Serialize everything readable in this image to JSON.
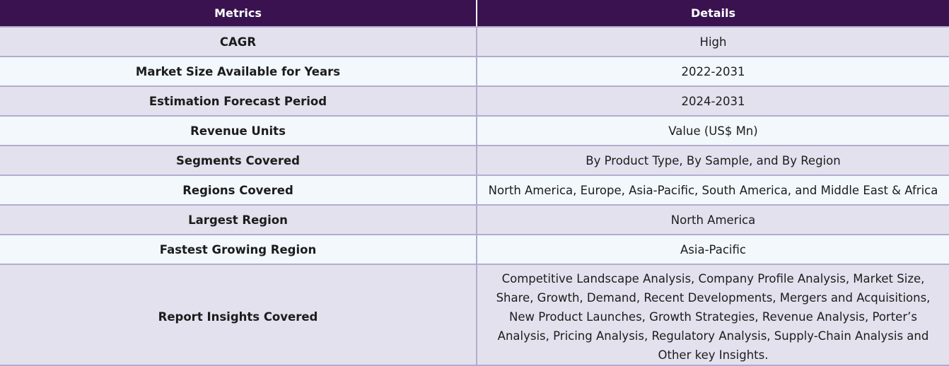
{
  "headers": {
    "metric": "Metrics",
    "detail": "Details"
  },
  "rows": [
    {
      "metric": "CAGR",
      "detail": "High"
    },
    {
      "metric": "Market Size Available for Years",
      "detail": "2022-2031"
    },
    {
      "metric": "Estimation Forecast Period",
      "detail": "2024-2031"
    },
    {
      "metric": "Revenue Units",
      "detail": "Value (US$ Mn)"
    },
    {
      "metric": "Segments Covered",
      "detail": "By Product Type, By Sample, and By Region"
    },
    {
      "metric": "Regions Covered",
      "detail": "North America, Europe, Asia-Pacific, South America, and Middle East & Africa"
    },
    {
      "metric": "Largest Region",
      "detail": "North America"
    },
    {
      "metric": "Fastest Growing Region",
      "detail": "Asia-Pacific"
    },
    {
      "metric": "Report Insights Covered",
      "detail": "Competitive Landscape Analysis, Company Profile Analysis, Market Size, Share, Growth, Demand, Recent Developments, Mergers and Acquisitions, New Product Launches, Growth Strategies, Revenue Analysis, Porter’s Analysis, Pricing Analysis, Regulatory Analysis, Supply-Chain Analysis and Other key Insights."
    }
  ]
}
